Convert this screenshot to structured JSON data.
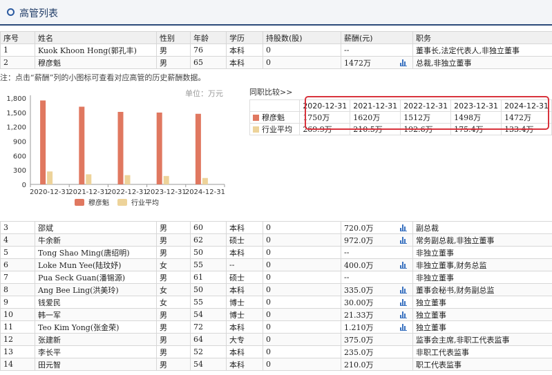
{
  "header": {
    "title": "高管列表"
  },
  "table_headers": [
    "序号",
    "姓名",
    "性别",
    "年龄",
    "学历",
    "持股数(股)",
    "薪酬(元)",
    "职务"
  ],
  "rows_top": [
    {
      "no": "1",
      "name": "Kuok Khoon Hong(郭孔丰)",
      "gender": "男",
      "age": "76",
      "edu": "本科",
      "shares": "0",
      "pay": "--",
      "icon": false,
      "role": "董事长,法定代表人,非独立董事"
    },
    {
      "no": "2",
      "name": "穆彦魁",
      "gender": "男",
      "age": "65",
      "edu": "本科",
      "shares": "0",
      "pay": "1472万",
      "icon": true,
      "role": "总裁,非独立董事"
    }
  ],
  "note": "注：点击“薪酬”列的小图标可查看对应高管的历史薪酬数据。",
  "unit_label": "单位：万元",
  "compare_link": "同职比较>>",
  "compare": {
    "dates": [
      "2020-12-31",
      "2021-12-31",
      "2022-12-31",
      "2023-12-31",
      "2024-12-31"
    ],
    "person_label": "穆彦魁",
    "person_values": [
      "1750万",
      "1620万",
      "1512万",
      "1498万",
      "1472万"
    ],
    "avg_label": "行业平均",
    "avg_values": [
      "269.9万",
      "210.5万",
      "192.6万",
      "175.4万",
      "133.4万"
    ]
  },
  "colors": {
    "person": "#e07860",
    "avg": "#edd39a",
    "highlight": "#d8323c",
    "header_line": "#2b4a7a",
    "icon": "#3a72c0"
  },
  "chart_data": {
    "type": "bar",
    "categories": [
      "2020-12-31",
      "2021-12-31",
      "2022-12-31",
      "2023-12-31",
      "2024-12-31"
    ],
    "series": [
      {
        "name": "穆彦魁",
        "values": [
          1750,
          1620,
          1512,
          1498,
          1472
        ]
      },
      {
        "name": "行业平均",
        "values": [
          269.9,
          210.5,
          192.6,
          175.4,
          133.4
        ]
      }
    ],
    "yticks": [
      "0",
      "300",
      "600",
      "900",
      "1,200",
      "1,500",
      "1,800"
    ],
    "ylim": [
      0,
      1800
    ],
    "legend": "bottom"
  },
  "rows_bottom": [
    {
      "no": "3",
      "name": "邵斌",
      "gender": "男",
      "age": "60",
      "edu": "本科",
      "shares": "0",
      "pay": "720.0万",
      "icon": true,
      "role": "副总裁"
    },
    {
      "no": "4",
      "name": "牛余新",
      "gender": "男",
      "age": "62",
      "edu": "硕士",
      "shares": "0",
      "pay": "972.0万",
      "icon": true,
      "role": "常务副总裁,非独立董事"
    },
    {
      "no": "5",
      "name": "Tong Shao Ming(唐绍明)",
      "gender": "男",
      "age": "50",
      "edu": "本科",
      "shares": "0",
      "pay": "--",
      "icon": false,
      "role": "非独立董事"
    },
    {
      "no": "6",
      "name": "Loke Mun Yee(陆玟妤)",
      "gender": "女",
      "age": "55",
      "edu": "--",
      "shares": "0",
      "pay": "400.0万",
      "icon": true,
      "role": "非独立董事,财务总监"
    },
    {
      "no": "7",
      "name": "Pua Seck Guan(潘锡源)",
      "gender": "男",
      "age": "61",
      "edu": "硕士",
      "shares": "0",
      "pay": "--",
      "icon": false,
      "role": "非独立董事"
    },
    {
      "no": "8",
      "name": "Ang Bee Ling(洪美玲)",
      "gender": "女",
      "age": "50",
      "edu": "本科",
      "shares": "0",
      "pay": "335.0万",
      "icon": true,
      "role": "董事会秘书,财务副总监"
    },
    {
      "no": "9",
      "name": "钱爱民",
      "gender": "女",
      "age": "55",
      "edu": "博士",
      "shares": "0",
      "pay": "30.00万",
      "icon": true,
      "role": "独立董事"
    },
    {
      "no": "10",
      "name": "韩一军",
      "gender": "男",
      "age": "54",
      "edu": "博士",
      "shares": "0",
      "pay": "21.33万",
      "icon": true,
      "role": "独立董事"
    },
    {
      "no": "11",
      "name": "Teo Kim Yong(张金荣)",
      "gender": "男",
      "age": "72",
      "edu": "本科",
      "shares": "0",
      "pay": "1.210万",
      "icon": true,
      "role": "独立董事"
    },
    {
      "no": "12",
      "name": "张建新",
      "gender": "男",
      "age": "64",
      "edu": "大专",
      "shares": "0",
      "pay": "375.0万",
      "icon": false,
      "role": "监事会主席,非职工代表监事"
    },
    {
      "no": "13",
      "name": "李长平",
      "gender": "男",
      "age": "52",
      "edu": "本科",
      "shares": "0",
      "pay": "235.0万",
      "icon": false,
      "role": "非职工代表监事"
    },
    {
      "no": "14",
      "name": "田元智",
      "gender": "男",
      "age": "54",
      "edu": "本科",
      "shares": "0",
      "pay": "210.0万",
      "icon": false,
      "role": "职工代表监事"
    }
  ]
}
